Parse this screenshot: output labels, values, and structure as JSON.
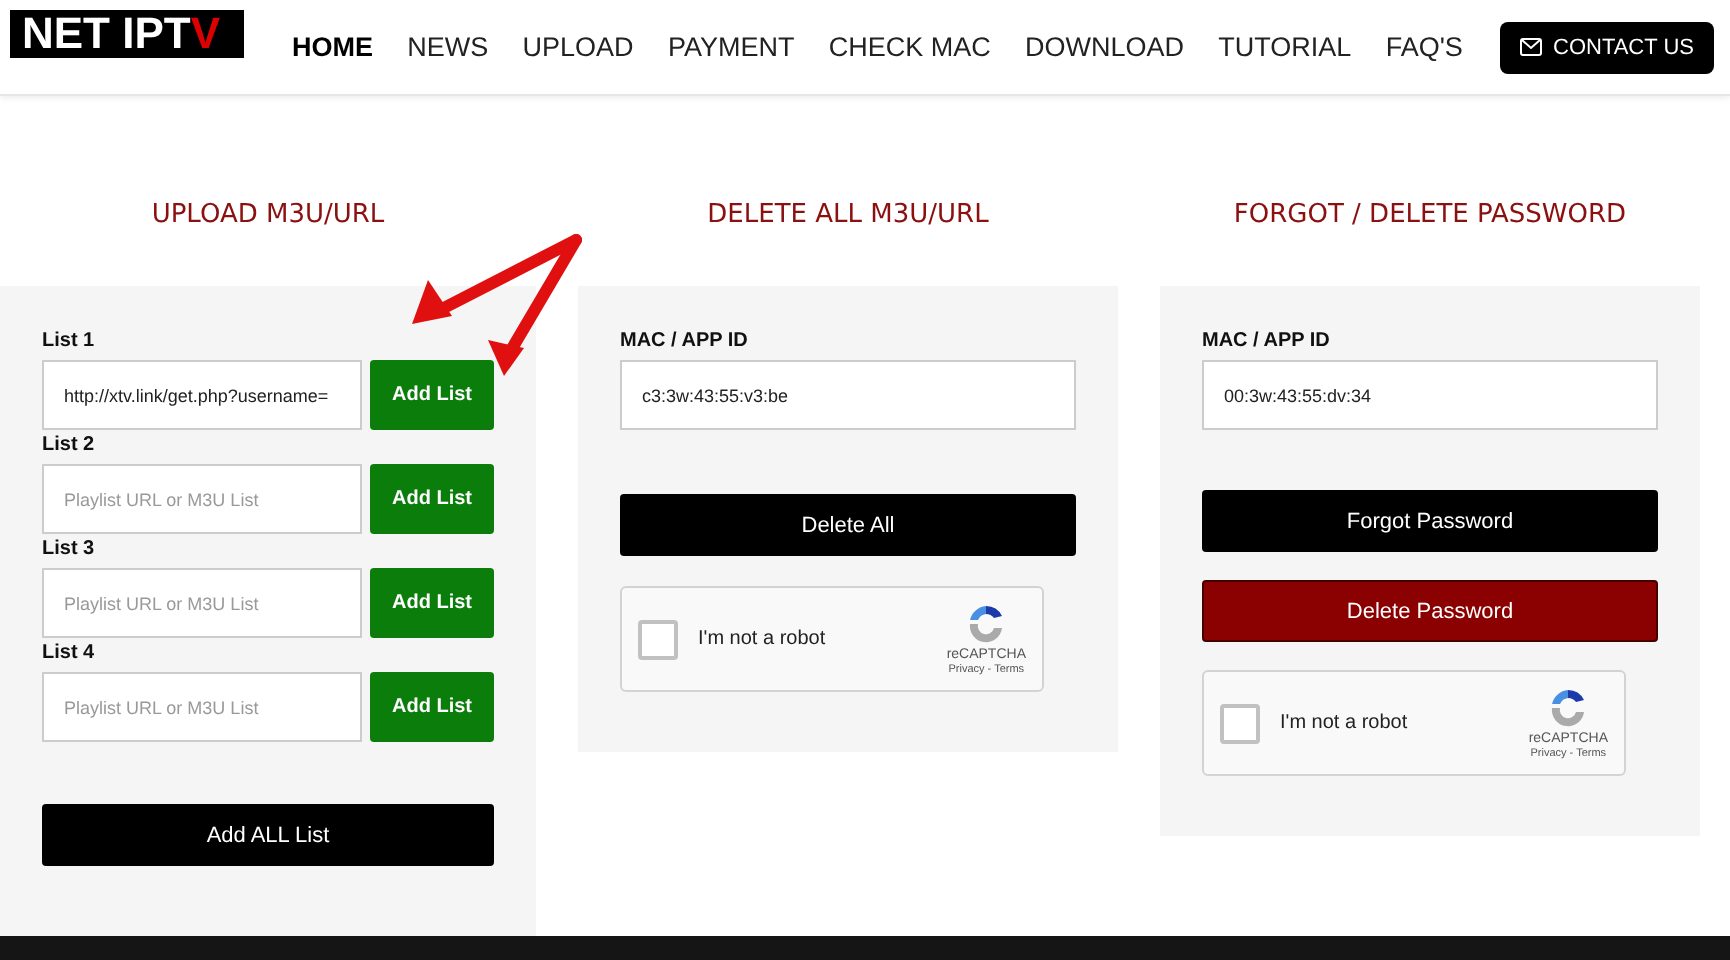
{
  "logo": {
    "text": "NET IPT",
    "mark": "V"
  },
  "nav": [
    {
      "label": "HOME",
      "selected": true
    },
    {
      "label": "NEWS",
      "selected": false
    },
    {
      "label": "UPLOAD",
      "selected": false
    },
    {
      "label": "PAYMENT",
      "selected": false
    },
    {
      "label": "CHECK MAC",
      "selected": false
    },
    {
      "label": "DOWNLOAD",
      "selected": false
    },
    {
      "label": "TUTORIAL",
      "selected": false
    },
    {
      "label": "FAQ'S",
      "selected": false
    }
  ],
  "contact_button": "CONTACT US",
  "upload": {
    "title": "UPLOAD M3U/URL",
    "lists": [
      {
        "label": "List 1",
        "value": "http://xtv.link/get.php?username=",
        "button": "Add List"
      },
      {
        "label": "List 2",
        "placeholder": "Playlist URL or M3U List",
        "button": "Add List"
      },
      {
        "label": "List 3",
        "placeholder": "Playlist URL or M3U List",
        "button": "Add List"
      },
      {
        "label": "List 4",
        "placeholder": "Playlist URL or M3U List",
        "button": "Add List"
      }
    ],
    "all_button": "Add ALL List"
  },
  "delete_all": {
    "title": "DELETE ALL M3U/URL",
    "field_label": "MAC / APP ID",
    "value": "c3:3w:43:55:v3:be",
    "button": "Delete All",
    "captcha": {
      "label": "I'm not a robot",
      "checked": false,
      "brand": "reCAPTCHA",
      "links": "Privacy - Terms"
    }
  },
  "forgot": {
    "title": "FORGOT / DELETE PASSWORD",
    "field_label": "MAC / APP ID",
    "value": "00:3w:43:55:dv:34",
    "buttons": [
      {
        "label": "Forgot Password",
        "kind": "dark"
      },
      {
        "label": "Delete Password",
        "kind": "danger"
      }
    ],
    "captcha": {
      "label": "I'm not a robot",
      "checked": false,
      "brand": "reCAPTCHA",
      "links": "Privacy - Terms"
    }
  }
}
